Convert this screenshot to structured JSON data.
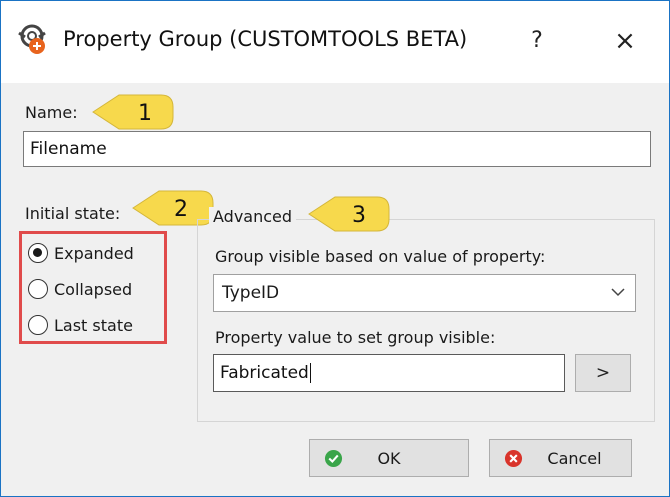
{
  "window": {
    "title": "Property Group (CUSTOMTOOLS BETA)",
    "help_label": "?",
    "close_label": "×"
  },
  "name_section": {
    "label": "Name:",
    "value": "Filename",
    "callout": "1"
  },
  "initial_state": {
    "label": "Initial state:",
    "callout": "2",
    "options": [
      {
        "label": "Expanded",
        "checked": true
      },
      {
        "label": "Collapsed",
        "checked": false
      },
      {
        "label": "Last state",
        "checked": false
      }
    ]
  },
  "advanced": {
    "title": "Advanced",
    "callout": "3",
    "visible_label": "Group visible based on value of property:",
    "property_value": "TypeID",
    "value_label": "Property value to set group visible:",
    "value_input": "Fabricated",
    "browse_label": ">"
  },
  "buttons": {
    "ok_label": "OK",
    "cancel_label": "Cancel"
  },
  "colors": {
    "callout_fill": "#f7d94c",
    "highlight_border": "#e04b4b",
    "ok_icon": "#3aa54a",
    "cancel_icon": "#d9342b"
  }
}
